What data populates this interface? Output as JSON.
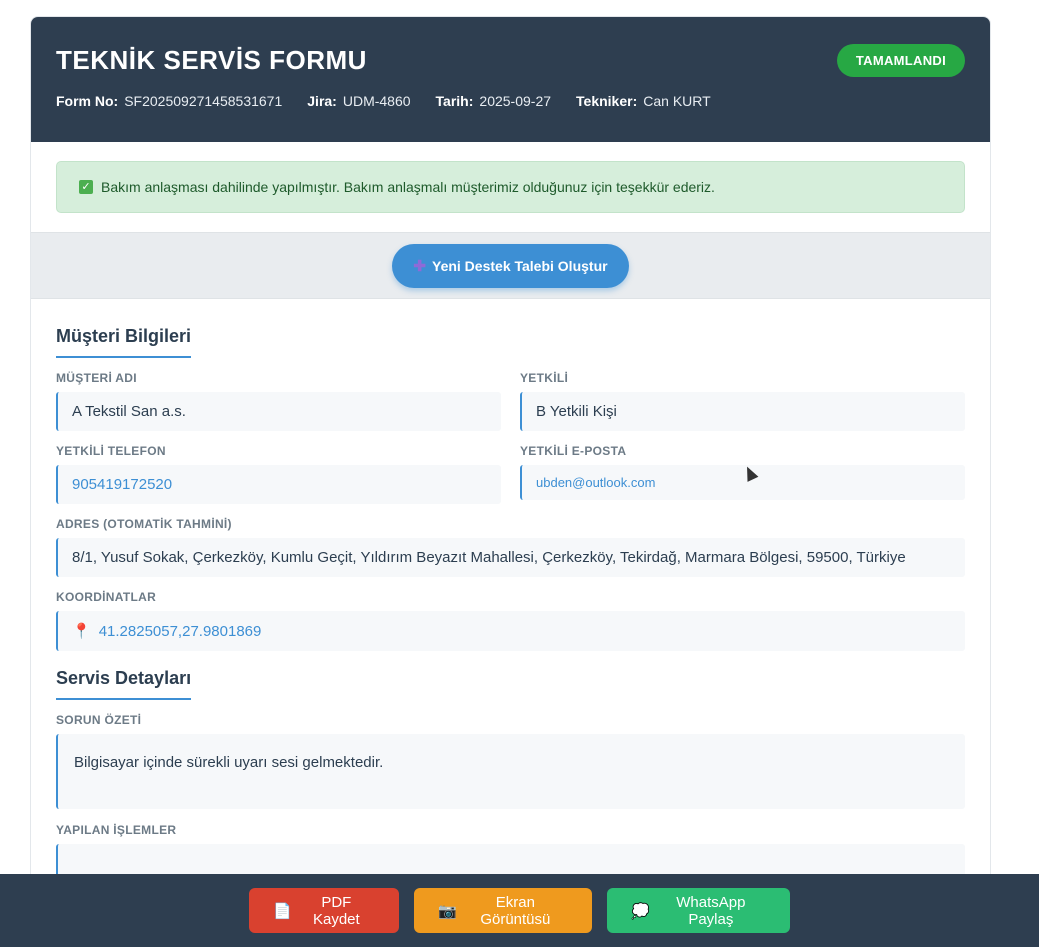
{
  "header": {
    "title": "TEKNİK SERVİS FORMU",
    "status": "TAMAMLANDI",
    "meta": [
      {
        "key": "Form No:",
        "value": "SF202509271458531671"
      },
      {
        "key": "Jira:",
        "value": "UDM-4860"
      },
      {
        "key": "Tarih:",
        "value": "2025-09-27"
      },
      {
        "key": "Tekniker:",
        "value": "Can KURT"
      }
    ]
  },
  "notice": {
    "icon": "check-box-icon",
    "text": "Bakım anlaşması dahilinde yapılmıştır. Bakım anlaşmalı müşterimiz olduğunuz için teşekkür ederiz."
  },
  "action": {
    "new_ticket_label": "Yeni Destek Talebi Oluştur"
  },
  "customer": {
    "section_title": "Müşteri Bilgileri",
    "name_label": "MÜŞTERİ ADI",
    "name": "A Tekstil San a.s.",
    "contact_label": "YETKİLİ",
    "contact": "B Yetkili Kişi",
    "phone_label": "YETKİLİ TELEFON",
    "phone": "905419172520",
    "email_label": "YETKİLİ E-POSTA",
    "email": "ubden@outlook.com",
    "address_label": "ADRES (OTOMATİK TAHMİNİ)",
    "address": "8/1, Yusuf Sokak, Çerkezköy, Kumlu Geçit, Yıldırım Beyazıt Mahallesi, Çerkezköy, Tekirdağ, Marmara Bölgesi, 59500, Türkiye",
    "coords_label": "KOORDİNATLAR",
    "coords": "41.2825057,27.9801869"
  },
  "service": {
    "section_title": "Servis Detayları",
    "problem_label": "SORUN ÖZETİ",
    "problem": "Bilgisayar içinde sürekli uyarı sesi gelmektedir.",
    "actions_label": "YAPILAN İŞLEMLER"
  },
  "footer": {
    "pdf_label": "PDF Kaydet",
    "screenshot_label": "Ekran Görüntüsü",
    "whatsapp_label": "WhatsApp Paylaş"
  },
  "colors": {
    "header": "#2e3e50",
    "accent": "#3d8fd4",
    "success": "#27a844"
  }
}
